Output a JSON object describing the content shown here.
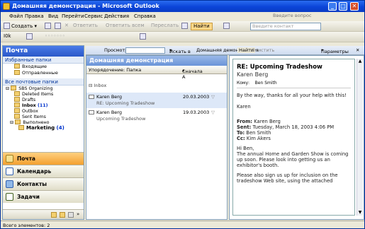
{
  "title": "Домашняя демонстрация - Microsoft Outlook",
  "menu": [
    "Файл",
    "Правка",
    "Вид",
    "Перейти",
    "Сервис",
    "Действия",
    "Справка"
  ],
  "ask_placeholder": "Введите вопрос",
  "toolbar1": {
    "create": "Создать",
    "reply": "Ответить",
    "reply_all": "Ответить всем",
    "forward": "Переслать",
    "find": "Найти",
    "address_placeholder": "Введите контакт"
  },
  "toolbar2": {
    "label": "I0k"
  },
  "nav": {
    "title": "Почта",
    "favorites_label": "Избранные папки",
    "favorites": [
      "Входящие",
      "Отправленные"
    ],
    "all_label": "Все почтовые папки",
    "tree": [
      {
        "label": "SBS Organizing",
        "count": ""
      },
      {
        "label": "Deleted Items",
        "count": ""
      },
      {
        "label": "Drafts",
        "count": ""
      },
      {
        "label": "Inbox",
        "count": "(11)"
      },
      {
        "label": "Outbox",
        "count": ""
      },
      {
        "label": "Sent Items",
        "count": ""
      },
      {
        "label": "Выполнено",
        "count": ""
      },
      {
        "label": "Marketing",
        "count": "(4)"
      }
    ],
    "buttons": [
      "Почта",
      "Календарь",
      "Контакты",
      "Задачи"
    ]
  },
  "findbar": {
    "lookin_label": "Просмотреть:",
    "search": "Искать в",
    "scope": "Домашняя демонстрация",
    "find_now": "Найти",
    "clear": "Очистить",
    "options": "Параметры"
  },
  "list": {
    "title": "Домашняя демонстрация",
    "arrange": "Упорядочение: Папка",
    "sort": "Сначала А",
    "group": "Inbox",
    "items": [
      {
        "from": "Karen Berg",
        "date": "20.03.2003",
        "subject": "RE: Upcoming Tradeshow"
      },
      {
        "from": "Karen Berg",
        "date": "19.03.2003",
        "subject": "Upcoming Tradeshow"
      }
    ]
  },
  "reading": {
    "subject": "RE: Upcoming Tradeshow",
    "from": "Karen Berg",
    "to_label": "Кому:",
    "to": "Ben Smith",
    "body1": "By the way, thanks for all your help with this!",
    "sig": "Karen",
    "q_from_label": "From:",
    "q_from": "Karen Berg",
    "q_sent_label": "Sent:",
    "q_sent": "Tuesday, March 18, 2003 4:06 PM",
    "q_to_label": "To:",
    "q_to": "Ben Smith",
    "q_cc_label": "Cc:",
    "q_cc": "Kim Akers",
    "greeting": "Hi Ben,",
    "para1": "The annual Home and Garden Show is coming up soon.  Please look into getting us an exhibitor's booth.",
    "para2": "Please also sign us up for inclusion on the tradeshow Web site, using the attached"
  },
  "status": "Всего элементов: 2"
}
